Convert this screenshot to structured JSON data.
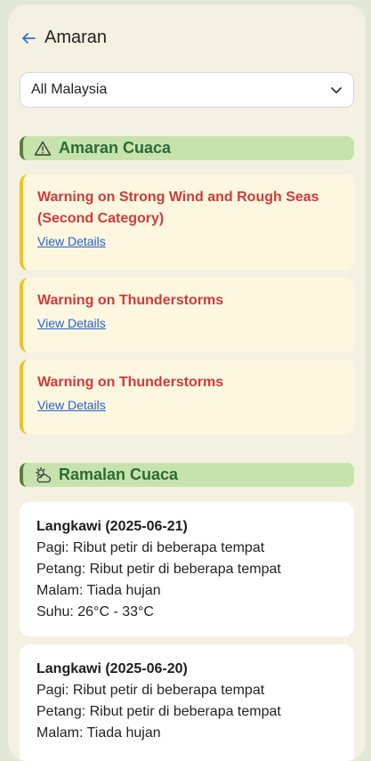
{
  "header": {
    "title": "Amaran",
    "back_icon": "arrow-left-icon"
  },
  "region_select": {
    "value": "All Malaysia",
    "icon": "chevron-down-icon"
  },
  "warnings_section": {
    "title": "Amaran Cuaca",
    "icon": "warning-triangle-icon",
    "items": [
      {
        "title": "Warning on Strong Wind and Rough Seas (Second Category)",
        "link": "View Details"
      },
      {
        "title": "Warning on Thunderstorms",
        "link": "View Details"
      },
      {
        "title": "Warning on Thunderstorms",
        "link": "View Details"
      }
    ]
  },
  "forecast_section": {
    "title": "Ramalan Cuaca",
    "icon": "sun-cloud-icon",
    "items": [
      {
        "title": "Langkawi (2025-06-21)",
        "morning": "Pagi: Ribut petir di beberapa tempat",
        "afternoon": "Petang: Ribut petir di beberapa tempat",
        "night": "Malam: Tiada hujan",
        "temp": "Suhu: 26°C - 33°C"
      },
      {
        "title": "Langkawi (2025-06-20)",
        "morning": "Pagi: Ribut petir di beberapa tempat",
        "afternoon": "Petang: Ribut petir di beberapa tempat",
        "night": "Malam: Tiada hujan",
        "temp": ""
      }
    ]
  },
  "colors": {
    "accent_blue": "#2563c9",
    "warning_red": "#d03a3a",
    "section_green": "#2b6b36",
    "section_bg": "#c7e3ad",
    "warning_bar": "#f1c21b"
  }
}
